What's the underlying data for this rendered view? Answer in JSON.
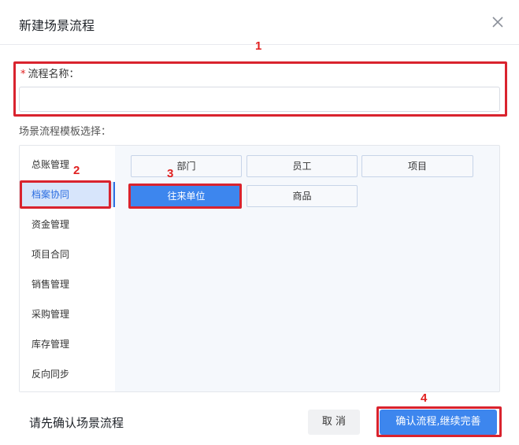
{
  "dialog": {
    "title": "新建场景流程",
    "close_icon": "close-icon"
  },
  "annotations": [
    "1",
    "2",
    "3",
    "4"
  ],
  "form": {
    "required_mark": "*",
    "name_label": "流程名称：",
    "name_value": "",
    "template_label": "场景流程模板选择："
  },
  "sidebar": {
    "items": [
      {
        "label": "总账管理"
      },
      {
        "label": "档案协同",
        "active": true
      },
      {
        "label": "资金管理"
      },
      {
        "label": "项目合同"
      },
      {
        "label": "销售管理"
      },
      {
        "label": "采购管理"
      },
      {
        "label": "库存管理"
      },
      {
        "label": "反向同步"
      }
    ]
  },
  "templates": {
    "items": [
      {
        "label": "部门"
      },
      {
        "label": "员工"
      },
      {
        "label": "项目"
      },
      {
        "label": "往来单位",
        "active": true
      },
      {
        "label": "商品"
      }
    ]
  },
  "footer": {
    "note": "请先确认场景流程",
    "cancel_label": "取 消",
    "confirm_label": "确认流程,继续完善"
  },
  "colors": {
    "accent": "#3d86ee",
    "annotation_red": "#d9232e"
  }
}
